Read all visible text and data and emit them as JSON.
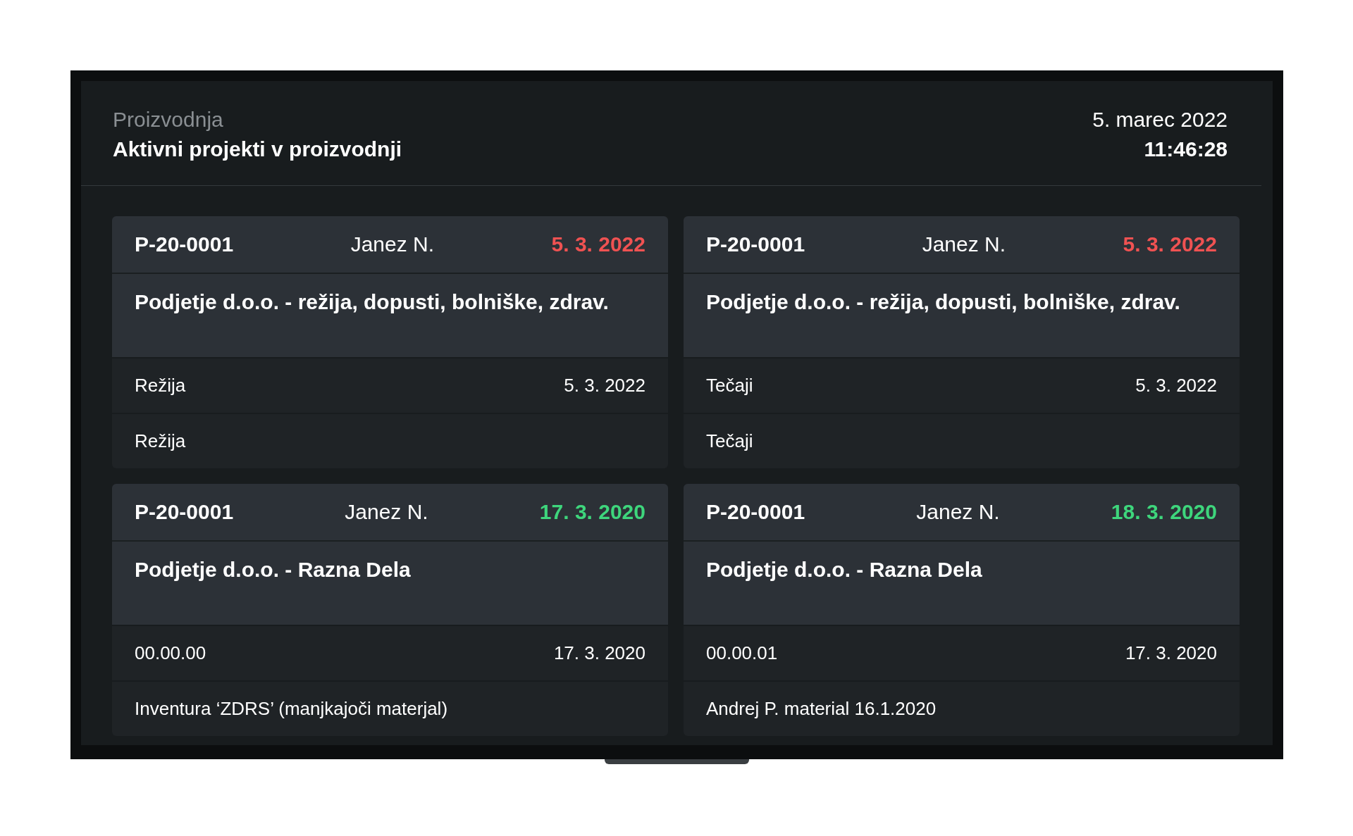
{
  "header": {
    "section": "Proizvodnja",
    "title": "Aktivni projekti v proizvodnji",
    "date": "5. marec 2022",
    "time": "11:46:28"
  },
  "cards": [
    {
      "code": "P-20-0001",
      "person": "Janez N.",
      "due_date": "5. 3. 2022",
      "color": "#f05252",
      "title": "Podjetje d.o.o. - režija, dopusti, bolniške, zdrav.",
      "rows": [
        {
          "label": "Režija",
          "date": "5. 3. 2022"
        },
        {
          "label": "Režija"
        }
      ]
    },
    {
      "code": "P-20-0001",
      "person": "Janez N.",
      "due_date": "5. 3. 2022",
      "color": "#f05252",
      "title": "Podjetje d.o.o. - režija, dopusti, bolniške, zdrav.",
      "rows": [
        {
          "label": "Tečaji",
          "date": "5. 3. 2022"
        },
        {
          "label": "Tečaji"
        }
      ]
    },
    {
      "code": "P-20-0001",
      "person": "Janez N.",
      "due_date": "17. 3. 2020",
      "color": "#3ed67c",
      "title": "Podjetje d.o.o. - Razna Dela",
      "rows": [
        {
          "label": "00.00.00",
          "date": "17. 3. 2020"
        },
        {
          "label": "Inventura ‘ZDRS’ (manjkajoči materjal)"
        }
      ]
    },
    {
      "code": "P-20-0001",
      "person": "Janez N.",
      "due_date": "18. 3. 2020",
      "color": "#3ed67c",
      "title": "Podjetje d.o.o. - Razna Dela",
      "rows": [
        {
          "label": "00.00.01",
          "date": "17. 3. 2020"
        },
        {
          "label": "Andrej P. material 16.1.2020"
        }
      ]
    }
  ]
}
